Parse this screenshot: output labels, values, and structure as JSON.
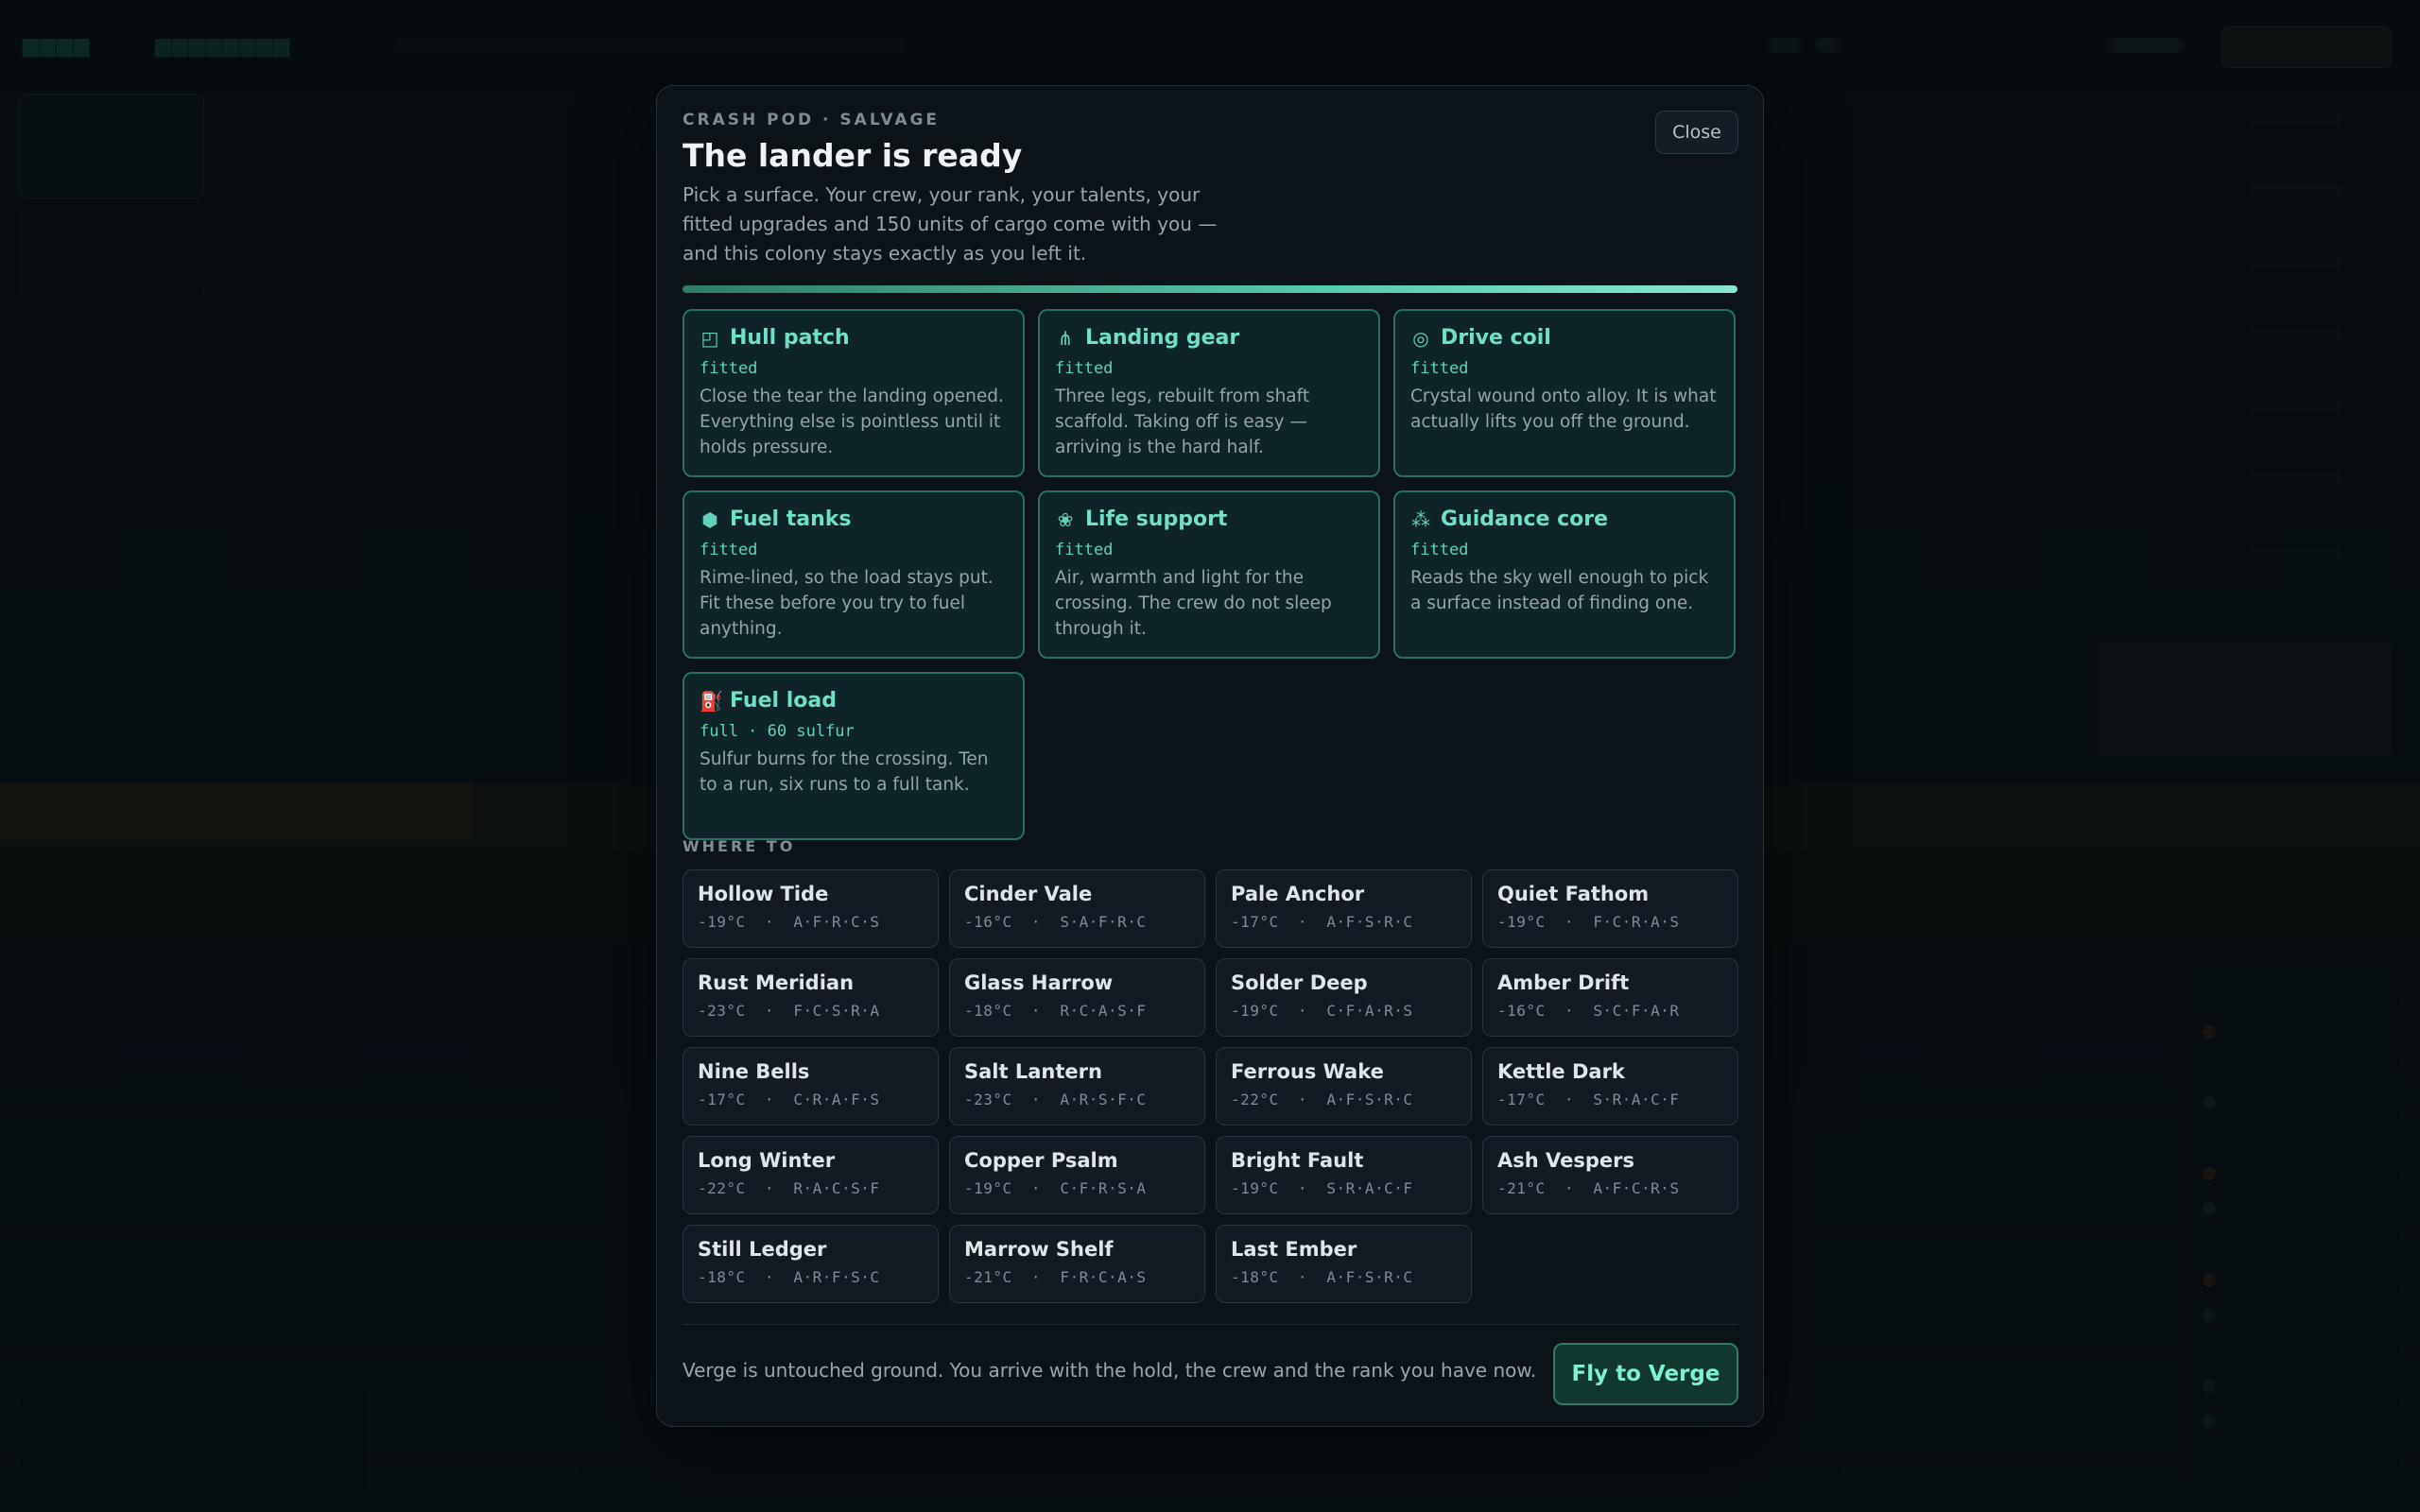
{
  "modal": {
    "eyebrow": "CRASH POD · SALVAGE",
    "title": "The lander is ready",
    "intro": "Pick a surface. Your crew, your rank, your talents, your fitted upgrades and 150 units of cargo come with you — and this colony stays exactly as you left it.",
    "close_label": "Close",
    "progress_fraction": 1.0
  },
  "upgrades": [
    {
      "icon": "hull-patch-icon",
      "glyph": "◰",
      "name": "Hull patch",
      "status": "fitted",
      "desc": "Close the tear the landing opened. Everything else is pointless until it holds pressure."
    },
    {
      "icon": "landing-gear-icon",
      "glyph": "⋔",
      "name": "Landing gear",
      "status": "fitted",
      "desc": "Three legs, rebuilt from shaft scaffold. Taking off is easy — arriving is the hard half."
    },
    {
      "icon": "drive-coil-icon",
      "glyph": "◎",
      "name": "Drive coil",
      "status": "fitted",
      "desc": "Crystal wound onto alloy. It is what actually lifts you off the ground."
    },
    {
      "icon": "fuel-tanks-icon",
      "glyph": "⬢",
      "name": "Fuel tanks",
      "status": "fitted",
      "desc": "Rime-lined, so the load stays put. Fit these before you try to fuel anything."
    },
    {
      "icon": "life-support-icon",
      "glyph": "❀",
      "name": "Life support",
      "status": "fitted",
      "desc": "Air, warmth and light for the crossing. The crew do not sleep through it."
    },
    {
      "icon": "guidance-core-icon",
      "glyph": "⁂",
      "name": "Guidance core",
      "status": "fitted",
      "desc": "Reads the sky well enough to pick a surface instead of finding one."
    },
    {
      "icon": "fuel-pump-icon",
      "glyph": "⛽",
      "name": "Fuel load",
      "status": "full · 60 sulfur",
      "desc": "Sulfur burns for the crossing. Ten to a run, six runs to a full tank."
    }
  ],
  "where_to_label": "WHERE TO",
  "destinations": [
    {
      "name": "Hollow Tide",
      "meta": "-19°C  ·  A·F·R·C·S"
    },
    {
      "name": "Cinder Vale",
      "meta": "-16°C  ·  S·A·F·R·C"
    },
    {
      "name": "Pale Anchor",
      "meta": "-17°C  ·  A·F·S·R·C"
    },
    {
      "name": "Quiet Fathom",
      "meta": "-19°C  ·  F·C·R·A·S"
    },
    {
      "name": "Rust Meridian",
      "meta": "-23°C  ·  F·C·S·R·A"
    },
    {
      "name": "Glass Harrow",
      "meta": "-18°C  ·  R·C·A·S·F"
    },
    {
      "name": "Solder Deep",
      "meta": "-19°C  ·  C·F·A·R·S"
    },
    {
      "name": "Amber Drift",
      "meta": "-16°C  ·  S·C·F·A·R"
    },
    {
      "name": "Nine Bells",
      "meta": "-17°C  ·  C·R·A·F·S"
    },
    {
      "name": "Salt Lantern",
      "meta": "-23°C  ·  A·R·S·F·C"
    },
    {
      "name": "Ferrous Wake",
      "meta": "-22°C  ·  A·F·S·R·C"
    },
    {
      "name": "Kettle Dark",
      "meta": "-17°C  ·  S·R·A·C·F"
    },
    {
      "name": "Long Winter",
      "meta": "-22°C  ·  R·A·C·S·F"
    },
    {
      "name": "Copper Psalm",
      "meta": "-19°C  ·  C·F·R·S·A"
    },
    {
      "name": "Bright Fault",
      "meta": "-19°C  ·  S·R·A·C·F"
    },
    {
      "name": "Ash Vespers",
      "meta": "-21°C  ·  A·F·C·R·S"
    },
    {
      "name": "Still Ledger",
      "meta": "-18°C  ·  A·R·F·S·C"
    },
    {
      "name": "Marrow Shelf",
      "meta": "-21°C  ·  F·R·C·A·S"
    },
    {
      "name": "Last Ember",
      "meta": "-18°C  ·  A·F·S·R·C"
    }
  ],
  "footer": {
    "text": "Verge is untouched ground. You arrive with the hold, the crew and the rank you have now.",
    "fly_label": "Fly to Verge"
  },
  "colors": {
    "accent": "#6fe0c5",
    "card_border": "#2b6f62",
    "button_bg": "#12372f"
  }
}
